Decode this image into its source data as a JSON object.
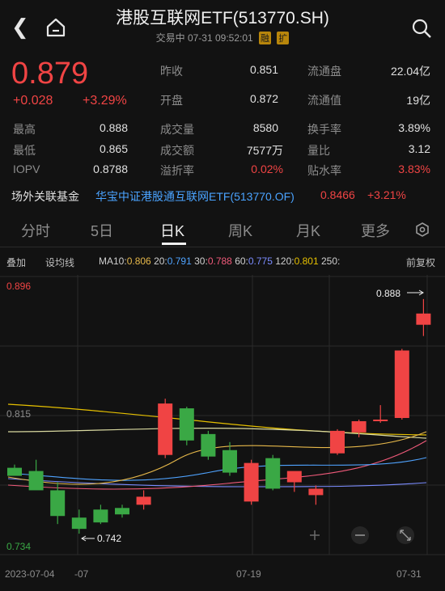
{
  "header": {
    "title": "港股互联网ETF(513770.SH)",
    "status": "交易中 07-31 09:52:01",
    "tag1": "融",
    "tag2": "扩"
  },
  "quote": {
    "price": "0.879",
    "change": "+0.028",
    "change_pct": "+3.29%"
  },
  "stats": [
    {
      "label": "昨收",
      "value": "0.851"
    },
    {
      "label": "流通盘",
      "value": "22.04亿"
    },
    {
      "label": "开盘",
      "value": "0.872"
    },
    {
      "label": "流通值",
      "value": "19亿"
    },
    {
      "label": "最高",
      "value": "0.888"
    },
    {
      "label": "成交量",
      "value": "8580"
    },
    {
      "label": "换手率",
      "value": "3.89%"
    },
    {
      "label": "最低",
      "value": "0.865"
    },
    {
      "label": "成交额",
      "value": "7577万"
    },
    {
      "label": "量比",
      "value": "3.12"
    },
    {
      "label": "IOPV",
      "value": "0.8788"
    },
    {
      "label": "溢折率",
      "value": "0.02%"
    },
    {
      "label": "贴水率",
      "value": "3.83%"
    }
  ],
  "fund": {
    "label": "场外关联基金",
    "name": "华宝中证港股通互联网ETF(513770.OF)",
    "price": "0.8466",
    "pct": "+3.21%"
  },
  "tabs": [
    "分时",
    "5日",
    "日K",
    "周K",
    "月K",
    "更多"
  ],
  "toolbar": {
    "overlay": "叠加",
    "settings": "设均线",
    "ma10_label": "MA10:",
    "ma10": "0.806",
    "ma20_label": "20:",
    "ma20": "0.791",
    "ma30_label": "30:",
    "ma30": "0.788",
    "ma60_label": "60:",
    "ma60": "0.775",
    "ma120_label": "120:",
    "ma120": "0.801",
    "ma250_label": "250:",
    "adjust": "前复权"
  },
  "colors": {
    "up": "#f04444",
    "down": "#3aa845",
    "ma10": "#e6b84a",
    "ma20": "#4fa3ff",
    "ma30": "#f05a7a",
    "ma60": "#7b8cff",
    "ma120": "#e6c000"
  },
  "chart_data": {
    "type": "candlestick",
    "ylim": [
      0.734,
      0.896
    ],
    "y_labels": {
      "top": "0.896",
      "mid": "0.815",
      "bottom": "0.734"
    },
    "annotations": {
      "high": "0.888",
      "low": "0.742"
    },
    "x_labels": [
      "2023-07-04",
      "-07",
      "07-19",
      "07-31"
    ],
    "candles": [
      {
        "o": 0.783,
        "h": 0.785,
        "l": 0.781,
        "c": 0.778
      },
      {
        "o": 0.781,
        "h": 0.788,
        "l": 0.77,
        "c": 0.769
      },
      {
        "o": 0.769,
        "h": 0.774,
        "l": 0.748,
        "c": 0.753
      },
      {
        "o": 0.752,
        "h": 0.757,
        "l": 0.742,
        "c": 0.745
      },
      {
        "o": 0.757,
        "h": 0.76,
        "l": 0.748,
        "c": 0.749
      },
      {
        "o": 0.758,
        "h": 0.76,
        "l": 0.752,
        "c": 0.754
      },
      {
        "o": 0.76,
        "h": 0.769,
        "l": 0.757,
        "c": 0.765
      },
      {
        "o": 0.791,
        "h": 0.826,
        "l": 0.789,
        "c": 0.823
      },
      {
        "o": 0.82,
        "h": 0.821,
        "l": 0.797,
        "c": 0.8
      },
      {
        "o": 0.804,
        "h": 0.806,
        "l": 0.788,
        "c": 0.79
      },
      {
        "o": 0.794,
        "h": 0.799,
        "l": 0.778,
        "c": 0.78
      },
      {
        "o": 0.762,
        "h": 0.788,
        "l": 0.76,
        "c": 0.786
      },
      {
        "o": 0.789,
        "h": 0.791,
        "l": 0.769,
        "c": 0.77
      },
      {
        "o": 0.774,
        "h": 0.78,
        "l": 0.768,
        "c": 0.781
      },
      {
        "o": 0.766,
        "h": 0.772,
        "l": 0.76,
        "c": 0.77
      },
      {
        "o": 0.792,
        "h": 0.807,
        "l": 0.791,
        "c": 0.806
      },
      {
        "o": 0.805,
        "h": 0.813,
        "l": 0.802,
        "c": 0.812
      },
      {
        "o": 0.812,
        "h": 0.822,
        "l": 0.811,
        "c": 0.813
      },
      {
        "o": 0.814,
        "h": 0.857,
        "l": 0.813,
        "c": 0.856
      },
      {
        "o": 0.872,
        "h": 0.888,
        "l": 0.865,
        "c": 0.879
      }
    ]
  }
}
